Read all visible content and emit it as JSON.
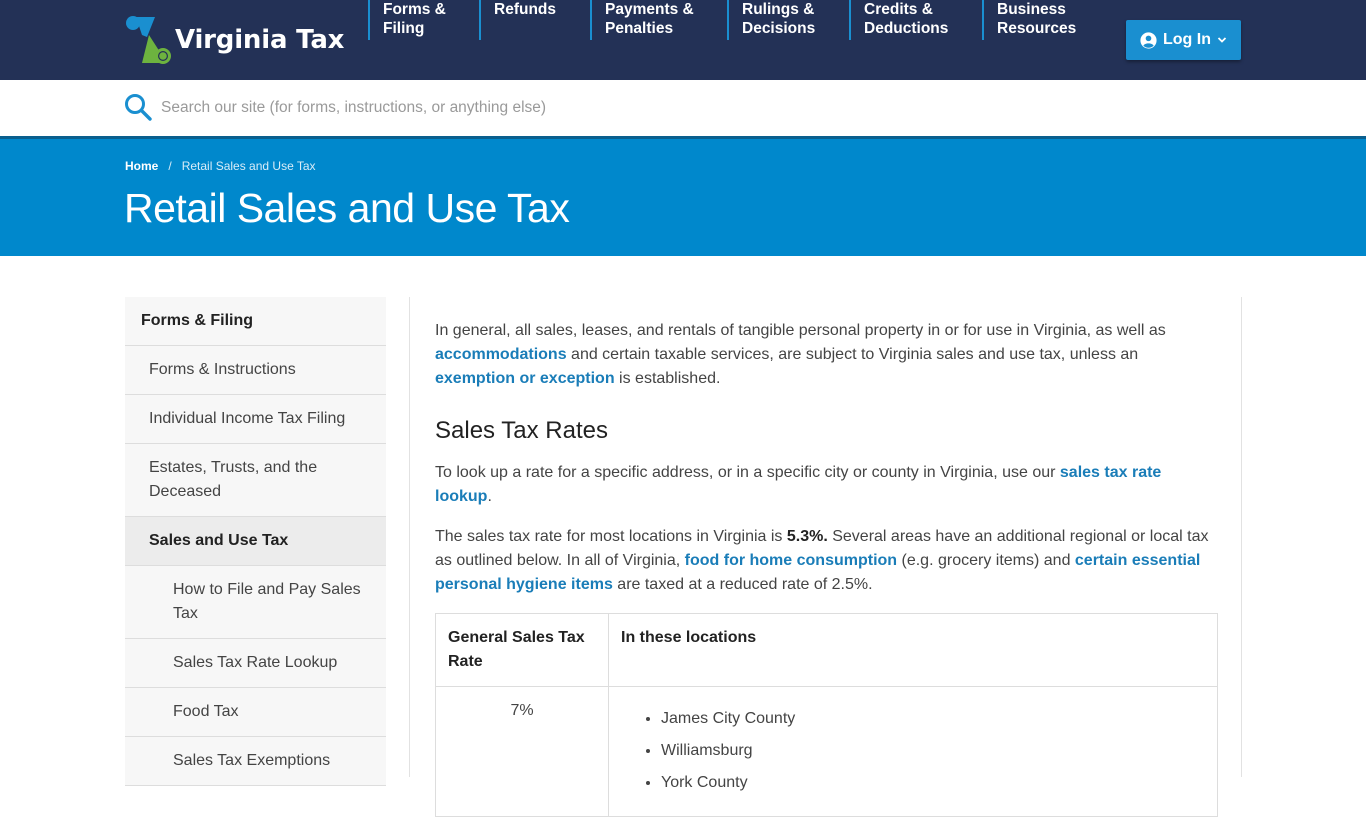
{
  "header": {
    "logo_text": "Virginia Tax",
    "nav": [
      {
        "line1": "Forms &",
        "line2": "Filing"
      },
      {
        "line1": "Refunds",
        "line2": ""
      },
      {
        "line1": "Payments &",
        "line2": "Penalties"
      },
      {
        "line1": "Rulings &",
        "line2": "Decisions"
      },
      {
        "line1": "Credits &",
        "line2": "Deductions"
      },
      {
        "line1": "Business",
        "line2": "Resources"
      }
    ],
    "login_label": "Log In",
    "colors": {
      "navy": "#233156",
      "accent_blue": "#1a8fd0",
      "logo_green": "#6db33f"
    }
  },
  "search": {
    "placeholder": "Search our site (for forms, instructions, or anything else)",
    "value": ""
  },
  "banner": {
    "breadcrumb_home": "Home",
    "breadcrumb_sep": "/",
    "breadcrumb_current": "Retail Sales and Use Tax",
    "title": "Retail Sales and Use Tax"
  },
  "sidebar": {
    "heading": "Forms & Filing",
    "items": [
      {
        "label": "Forms & Instructions"
      },
      {
        "label": "Individual Income Tax Filing"
      },
      {
        "label": "Estates, Trusts, and the Deceased"
      },
      {
        "label": "Sales and Use Tax",
        "active": true
      },
      {
        "label": "How to File and Pay Sales Tax",
        "sub": true
      },
      {
        "label": "Sales Tax Rate Lookup",
        "sub": true
      },
      {
        "label": "Food Tax",
        "sub": true
      },
      {
        "label": "Sales Tax Exemptions",
        "sub": true
      }
    ]
  },
  "main": {
    "intro": {
      "t1": "In general, all sales, leases, and rentals of tangible personal property in or for use in Virginia, as well as ",
      "link1": "accommodations",
      "t2": " and certain taxable services, are subject to Virginia sales and use tax, unless an ",
      "link2": "exemption or exception",
      "t3": " is established."
    },
    "heading": "Sales Tax Rates",
    "lookup": {
      "t1": "To look up a rate for a specific address, or in a specific city or county in Virginia, use our ",
      "link": "sales tax rate lookup",
      "t2": "."
    },
    "rates": {
      "t1": "The sales tax rate for most locations in Virginia is ",
      "bold": "5.3%.",
      "t2": " Several areas have an additional regional or local tax as outlined below. In all of Virginia, ",
      "link1": "food for home consumption",
      "t3": " (e.g. grocery items) and ",
      "link2": "certain essential personal hygiene items",
      "t4": " are taxed at a reduced rate of 2.5%."
    },
    "table": {
      "headers": [
        "General Sales Tax Rate",
        "In these locations"
      ],
      "rows": [
        {
          "rate": "7%",
          "locations": [
            "James City County",
            "Williamsburg",
            "York County"
          ]
        }
      ]
    }
  }
}
